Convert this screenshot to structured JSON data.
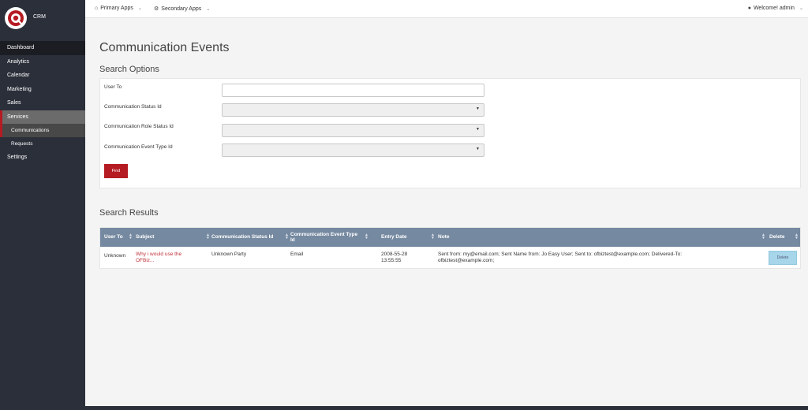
{
  "app": {
    "name": "CRM"
  },
  "colors": {
    "sidebar": "#2b2f3a",
    "accent": "#b51b22",
    "table_header": "#7589a0",
    "link": "#c0313a",
    "delete_button": "#a7d6ea"
  },
  "sidebar": {
    "items": [
      {
        "label": "Dashboard"
      },
      {
        "label": "Analytics"
      },
      {
        "label": "Calendar"
      },
      {
        "label": "Marketing"
      },
      {
        "label": "Sales"
      },
      {
        "label": "Services"
      }
    ],
    "services_sub": [
      {
        "label": "Communications"
      },
      {
        "label": "Requests"
      }
    ],
    "settings": {
      "label": "Settings"
    }
  },
  "topbar": {
    "primary_apps": {
      "label": "Primary Apps",
      "icon": "home-icon"
    },
    "secondary_apps": {
      "label": "Secondary Apps",
      "icon": "gear-icon"
    },
    "user": {
      "label": "Welcome! admin",
      "icon": "user-icon"
    }
  },
  "page": {
    "title": "Communication Events"
  },
  "search_options": {
    "heading": "Search Options",
    "fields": {
      "user_to": {
        "label": "User To",
        "value": ""
      },
      "status_id": {
        "label": "Communication Status Id",
        "value": ""
      },
      "role_status_id": {
        "label": "Communication Role Status Id",
        "value": ""
      },
      "event_type_id": {
        "label": "Communication Event Type Id",
        "value": ""
      }
    },
    "find_label": "Find"
  },
  "search_results": {
    "heading": "Search Results",
    "columns": {
      "user_to": "User To",
      "subject": "Subject",
      "status": "Communication Status Id",
      "event_type": "Communication Event Type Id",
      "entry_date": "Entry Date",
      "note": "Note",
      "delete": "Delete"
    },
    "rows": [
      {
        "user_to": "Unknown",
        "subject": "Why i would use the OFBiz...",
        "status": "Unknown Party",
        "event_type": "Email",
        "entry_date": "2008-55-28 13:55:55",
        "note": "Sent from: my@email.com; Sent Name from: Jo Easy User; Sent to: ofbiztest@example.com; Delivered-To: ofbiztest@example.com;",
        "delete_label": "Delete"
      }
    ]
  }
}
